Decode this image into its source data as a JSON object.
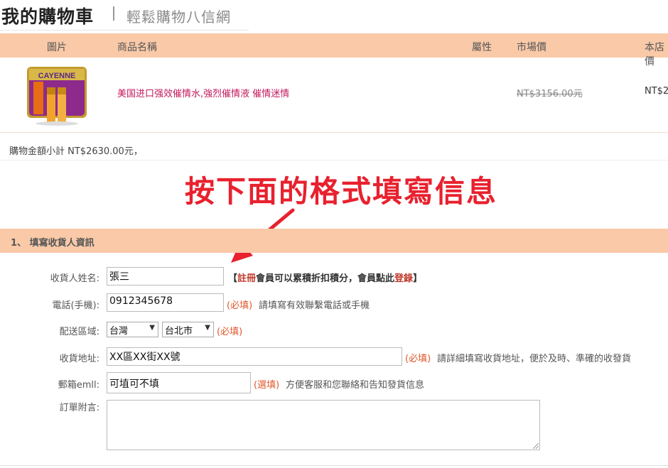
{
  "header": {
    "title": "我的購物車",
    "subtitle": "輕鬆購物八信網"
  },
  "cart": {
    "columns": [
      "圖片",
      "商品名稱",
      "屬性",
      "市場價",
      "本店價"
    ],
    "items": [
      {
        "image_text": "CAYENNE",
        "name": "美国进口强效催情水,強烈催情液 催情迷情",
        "attributes": "",
        "market_price": "NT$3156.00元",
        "store_price": "NT$2"
      }
    ],
    "subtotal": "購物金額小計 NT$2630.00元，"
  },
  "annotation": "按下面的格式填寫信息",
  "form": {
    "section_title": "1、 填寫收貨人資訊",
    "member_note": {
      "prefix": "【",
      "register": "註冊",
      "middle": "會員可以累積折扣積分，會員點此",
      "login": "登錄",
      "suffix": "】"
    },
    "name": {
      "label": "收貨人姓名:",
      "value": "張三"
    },
    "phone": {
      "label": "電話(手機):",
      "value": "0912345678",
      "required": "(必填)",
      "hint": "請填寫有效聯繫電話或手機"
    },
    "region": {
      "label": "配送區域:",
      "country": "台灣",
      "city": "台北市",
      "required": "(必填)"
    },
    "address": {
      "label": "收貨地址:",
      "value": "XX區XX街XX號",
      "required": "(必填)",
      "hint": "請詳細填寫收貨地址，便於及時、準確的收發貨"
    },
    "email": {
      "label": "郵箱emll:",
      "value": "可埴可不填",
      "optional": "(選填)",
      "hint": "方便客服和您聯絡和告知發貨信息"
    },
    "notes": {
      "label": "訂單附言:",
      "value": ""
    }
  },
  "colors": {
    "header_bg": "#f9c9a8",
    "product_link": "#c2185b",
    "required": "#e0572a",
    "annotation": "#e8212e"
  },
  "icons": [
    "dropdown-arrow-icon",
    "annotation-arrow-icon",
    "resize-handle-icon"
  ]
}
